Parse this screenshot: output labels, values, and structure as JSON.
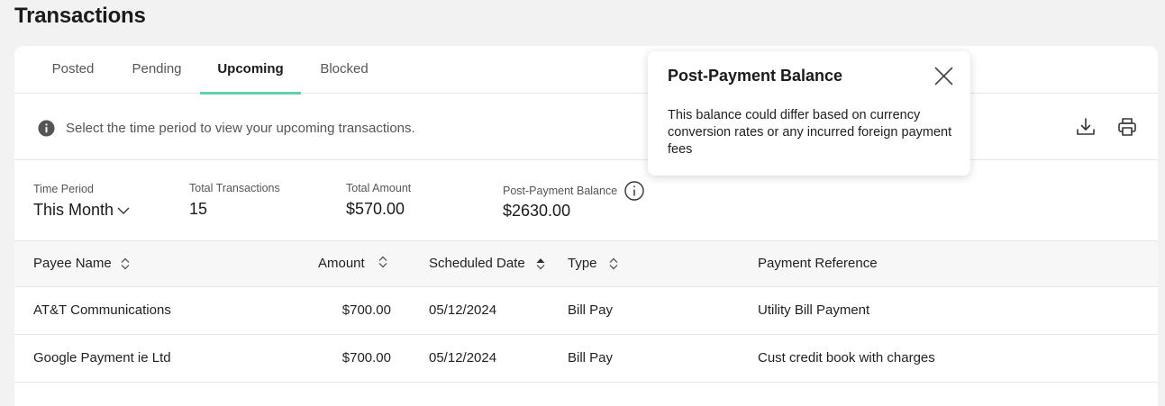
{
  "page": {
    "title": "Transactions"
  },
  "tabs": [
    {
      "label": "Posted"
    },
    {
      "label": "Pending"
    },
    {
      "label": "Upcoming"
    },
    {
      "label": "Blocked"
    }
  ],
  "info": {
    "message": "Select the time period to view your upcoming transactions."
  },
  "toolbar": {
    "icons": [
      "download-icon",
      "print-icon"
    ]
  },
  "summary": {
    "time_period": {
      "label": "Time Period",
      "value": "This Month"
    },
    "total_transactions": {
      "label": "Total Transactions",
      "value": "15"
    },
    "total_amount": {
      "label": "Total Amount",
      "value": "$570.00"
    },
    "post_payment_balance": {
      "label": "Post-Payment Balance",
      "value": "$2630.00"
    }
  },
  "table": {
    "columns": [
      {
        "label": "Payee Name"
      },
      {
        "label": "Amount"
      },
      {
        "label": "Scheduled Date"
      },
      {
        "label": "Type"
      },
      {
        "label": "Payment Reference"
      }
    ],
    "rows": [
      {
        "payee": "AT&T Communications",
        "amount": "$700.00",
        "date": "05/12/2024",
        "type": "Bill Pay",
        "reference": "Utility Bill Payment"
      },
      {
        "payee": "Google Payment ie Ltd",
        "amount": "$700.00",
        "date": "05/12/2024",
        "type": "Bill Pay",
        "reference": "Cust credit book with charges"
      }
    ]
  },
  "popover": {
    "title": "Post-Payment Balance",
    "body": "This balance could differ based on currency conversion rates or any incurred foreign payment fees"
  },
  "colors": {
    "accent": "#5fd3a7",
    "info_icon": "#555555",
    "background": "#f2f2f2"
  }
}
